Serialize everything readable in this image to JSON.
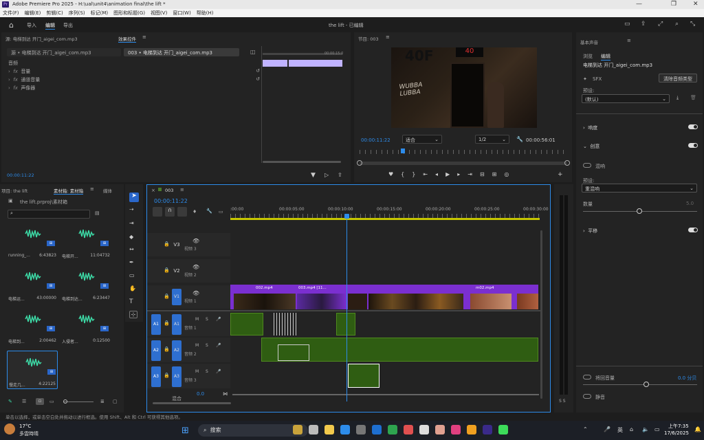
{
  "window": {
    "title": "Adobe Premiere Pro 2025 - H:\\ual\\unit4\\animation final\\the lift *",
    "icon": "Pr"
  },
  "menu": [
    "文件(F)",
    "编辑(E)",
    "剪辑(C)",
    "序列(S)",
    "标记(M)",
    "图形和标题(G)",
    "视图(V)",
    "窗口(W)",
    "帮助(H)"
  ],
  "workspace": {
    "tabs": [
      "导入",
      "编辑",
      "导出"
    ],
    "active": "编辑",
    "project_title": "the lift - 已编辑"
  },
  "source_panel": {
    "title": "源: 电梯到达 开门_aigei_com.mp3",
    "effects_tab": "效果控件",
    "sub_tab1": "源 • 电梯到达 开门_aigei_com.mp3",
    "sub_tab2": "003 • 电梯到达 开门_aigei_com.mp3",
    "section": "音频",
    "items": [
      "音量",
      "通道音量",
      "声像器"
    ],
    "timecode": "00:00:11:22",
    "mini_time": "00:00:15:0"
  },
  "program_panel": {
    "title": "节目: 003",
    "timecode": "00:00:11:22",
    "fit": "适合",
    "res": "1/2",
    "duration": "00:00:56:01",
    "overlay_text": "40F",
    "floor": "40",
    "graffiti": "WUBBA LUBBA"
  },
  "project_panel": {
    "tab1": "项目: the lift",
    "tab2": "素材箱: 素材箱",
    "tab3": "媒体",
    "path": "the lift.prproj\\素材箱",
    "items": [
      {
        "name": "running_...",
        "dur": "6:43823"
      },
      {
        "name": "电梯开...",
        "dur": "11:04732"
      },
      {
        "name": "电梯运...",
        "dur": "43:00000"
      },
      {
        "name": "电梯到达...",
        "dur": "6:23447"
      },
      {
        "name": "电梯到...",
        "dur": "2:00462"
      },
      {
        "name": "入侵者...",
        "dur": "0:12500"
      },
      {
        "name": "慢走几...",
        "dur": "4:22125"
      }
    ]
  },
  "timeline": {
    "seq": "003",
    "timecode": "00:00:11:22",
    "ruler": [
      ":00:00",
      "00:00:05:00",
      "00:00:10:00",
      "00:00:15:00",
      "00:00:20:00",
      "00:00:25:00",
      "00:00:30:00"
    ],
    "video_tracks": [
      {
        "id": "V3",
        "name": "视频 3"
      },
      {
        "id": "V2",
        "name": "视频 2"
      },
      {
        "id": "V1",
        "name": "视频 1"
      }
    ],
    "audio_tracks": [
      {
        "id": "A1",
        "name": "音频 1"
      },
      {
        "id": "A2",
        "name": "音频 2"
      },
      {
        "id": "A3",
        "name": "音频 3"
      }
    ],
    "mix": "混合",
    "mix_val": "0.0",
    "clip_labels": [
      "002.mp4",
      "003.mp4 [11...",
      "m02.mp4"
    ]
  },
  "essential_sound": {
    "title": "基本声音",
    "tabs": [
      "浏览",
      "编辑"
    ],
    "clip": "电梯到达 开门_aigei_com.mp3",
    "type": "SFX",
    "clear_btn": "清除音频类型",
    "preset_label": "预设:",
    "preset_val": "(默认)",
    "loudness": "响度",
    "creative": "创意",
    "reverb": "混响",
    "preset2": "预设:",
    "preset2_val": "重混响",
    "amount": "数量",
    "amount_val": "5.0",
    "pan": "平移",
    "duck": "将回音量",
    "duck_val": "0.0 分贝",
    "mute": "静音"
  },
  "status": "单击以选择，或单击空白处并拖动以进行框选。使用 Shift、Alt 和 Ctrl 可获得其他选项。",
  "taskbar": {
    "temp": "17°C",
    "weather": "多雲時晴",
    "search": "搜索",
    "ime": "英",
    "time": "上午7:35",
    "date": "17/6/2025"
  },
  "vu_label": "S S"
}
